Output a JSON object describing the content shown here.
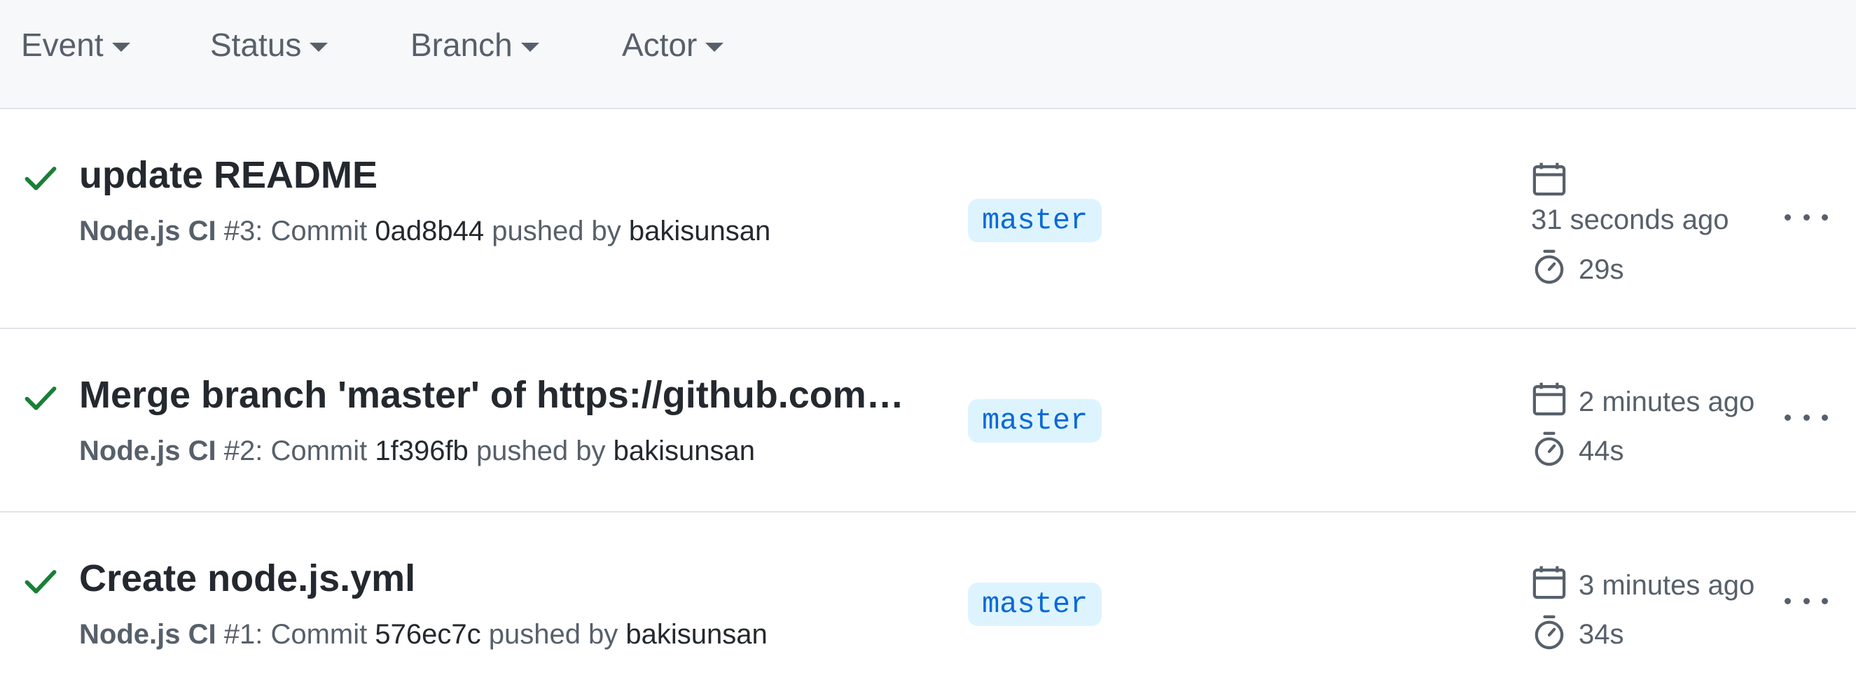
{
  "filters": {
    "event": "Event",
    "status": "Status",
    "branch": "Branch",
    "actor": "Actor"
  },
  "colors": {
    "success": "#1a7f37",
    "branch_bg": "#ddf4ff",
    "branch_text": "#0969da",
    "muted": "#57606a"
  },
  "runs": [
    {
      "status_icon": "check-icon",
      "title": "update README",
      "workflow": "Node.js CI",
      "run_number": "#3",
      "commit_label": ": Commit",
      "sha": "0ad8b44",
      "pushed_by_label": "pushed by",
      "actor": "bakisunsan",
      "branch": "master",
      "when": "31 seconds ago",
      "duration": "29s"
    },
    {
      "status_icon": "check-icon",
      "title": "Merge branch 'master' of https://github.com/…",
      "workflow": "Node.js CI",
      "run_number": "#2",
      "commit_label": ": Commit",
      "sha": "1f396fb",
      "pushed_by_label": "pushed by",
      "actor": "bakisunsan",
      "branch": "master",
      "when": "2 minutes ago",
      "duration": "44s"
    },
    {
      "status_icon": "check-icon",
      "title": "Create node.js.yml",
      "workflow": "Node.js CI",
      "run_number": "#1",
      "commit_label": ": Commit",
      "sha": "576ec7c",
      "pushed_by_label": "pushed by",
      "actor": "bakisunsan",
      "branch": "master",
      "when": "3 minutes ago",
      "duration": "34s"
    }
  ]
}
